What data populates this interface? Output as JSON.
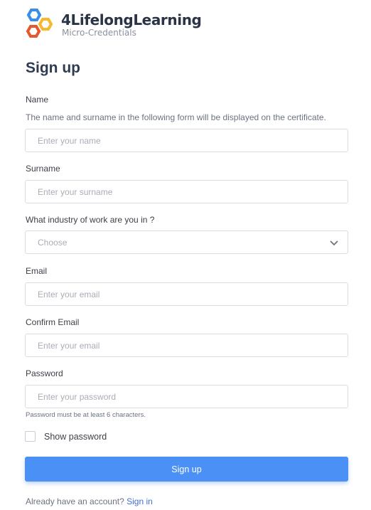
{
  "logo": {
    "title": "4LifelongLearning",
    "subtitle": "Micro-Credentials",
    "colors": [
      "#3a8ee6",
      "#f5b82e",
      "#e8572b"
    ]
  },
  "page_title": "Sign up",
  "name": {
    "label": "Name",
    "description": "The name and surname in the following form will be displayed on the certificate.",
    "placeholder": "Enter your name",
    "value": ""
  },
  "surname": {
    "label": "Surname",
    "placeholder": "Enter your surname",
    "value": ""
  },
  "industry": {
    "label": "What industry of work are you in ?",
    "selected": "Choose"
  },
  "email": {
    "label": "Email",
    "placeholder": "Enter your email",
    "value": ""
  },
  "confirm_email": {
    "label": "Confirm Email",
    "placeholder": "Enter your email",
    "value": ""
  },
  "password": {
    "label": "Password",
    "placeholder": "Enter your password",
    "value": "",
    "hint": "Password must be at least 6 characters."
  },
  "show_password": {
    "label": "Show password",
    "checked": false
  },
  "submit": {
    "label": "Sign up",
    "color": "#4a90f5"
  },
  "footer": {
    "text": "Already have an account?",
    "link": "Sign in"
  }
}
